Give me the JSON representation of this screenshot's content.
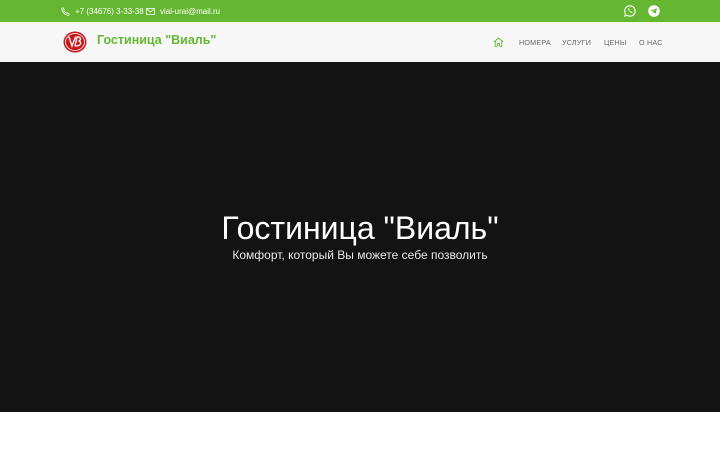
{
  "topbar": {
    "phone": "+7 (34676) 3-33-38",
    "email": "vial-urai@mail.ru",
    "phone_icon": "phone-icon",
    "email_icon": "mail-icon",
    "social": [
      "whatsapp-icon",
      "telegram-icon"
    ]
  },
  "header": {
    "title": "Гостиница \"Виаль\"",
    "logo_icon": "hotel-logo",
    "nav": {
      "home_icon": "home-icon",
      "rooms": "НОМЕРА",
      "services": "УСЛУГИ",
      "prices": "ЦЕНЫ",
      "about": "О НАС"
    }
  },
  "hero": {
    "title": "Гостиница \"Виаль\"",
    "subtitle": "Комфорт, который Вы можете себе позволить"
  },
  "colors": {
    "accent": "#65b731",
    "header_bg": "#f7f7f7",
    "hero_bg": "#131313",
    "logo_red": "#c8191e"
  }
}
